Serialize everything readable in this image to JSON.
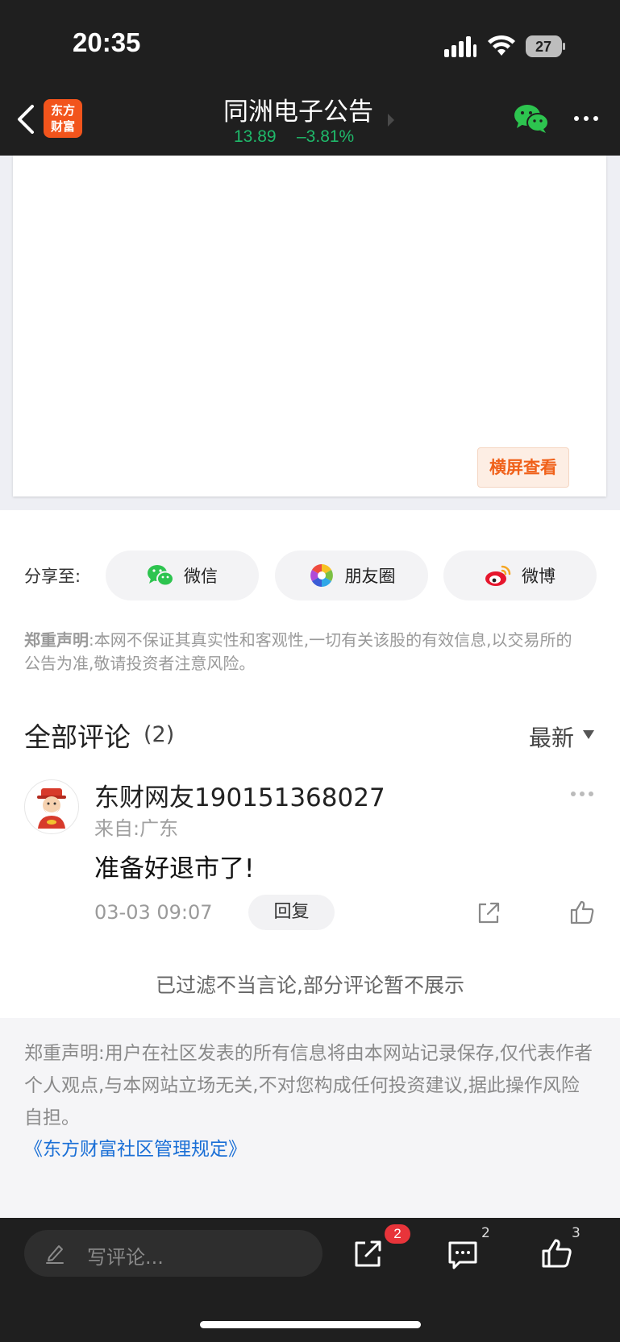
{
  "status_bar": {
    "time": "20:35",
    "battery": "27"
  },
  "header": {
    "logo_line1": "东方",
    "logo_line2": "财富",
    "title": "同洲电子公告",
    "price": "13.89",
    "change_pct": "–3.81%",
    "price_color": "#1fb96a"
  },
  "content": {
    "landscape_label": "横屏查看"
  },
  "share": {
    "label": "分享至:",
    "items": [
      {
        "label": "微信",
        "icon": "wechat-icon"
      },
      {
        "label": "朋友圈",
        "icon": "moments-icon"
      },
      {
        "label": "微博",
        "icon": "weibo-icon"
      }
    ]
  },
  "disclaimer_top": {
    "heading": "郑重声明",
    "text": ":本网不保证其真实性和客观性,一切有关该股的有效信息,以交易所的公告为准,敬请投资者注意风险。"
  },
  "comments": {
    "title": "全部评论",
    "count": "(2)",
    "sort_label": "最新",
    "items": [
      {
        "username": "东财网友190151368027",
        "location": "来自:广东",
        "text": "准备好退市了!",
        "time": "03-03 09:07",
        "reply_label": "回复"
      }
    ],
    "filtered_note": "已过滤不当言论,部分评论暂不展示"
  },
  "disclaimer_bottom": {
    "text": "郑重声明:用户在社区发表的所有信息将由本网站记录保存,仅代表作者个人观点,与本网站立场无关,不对您构成任何投资建议,据此操作风险自担。",
    "link": "《东方财富社区管理规定》"
  },
  "bottom_bar": {
    "input_placeholder": "写评论...",
    "share_badge": "2",
    "comment_count": "2",
    "like_count": "3"
  },
  "colors": {
    "accent": "#f2541c",
    "link": "#1a6fd6",
    "badge": "#e8343a"
  }
}
